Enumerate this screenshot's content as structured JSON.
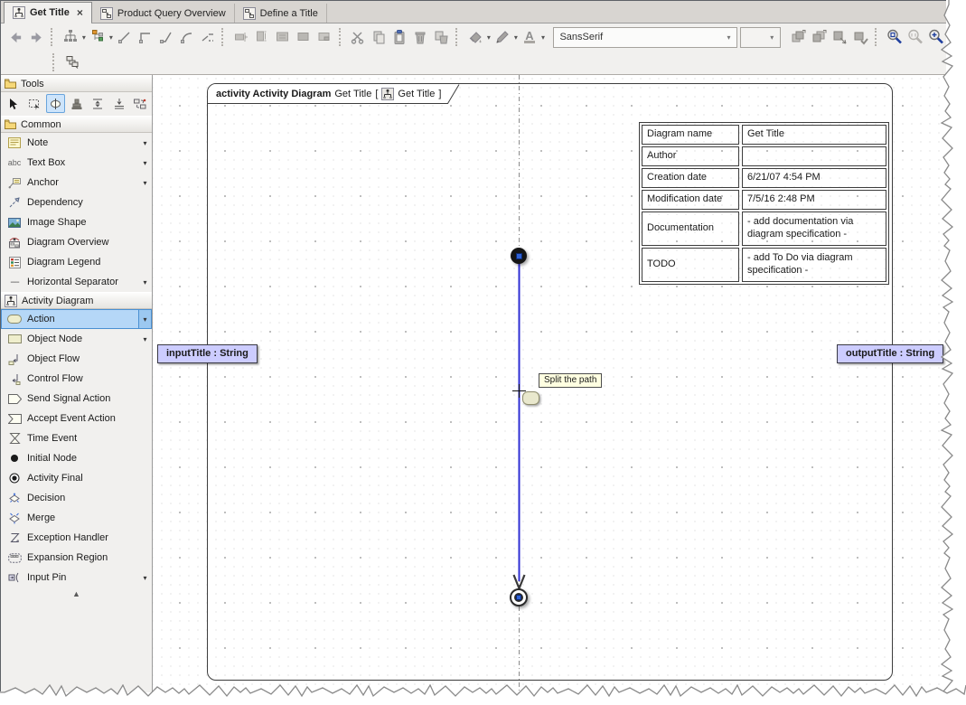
{
  "tabs": [
    {
      "label": "Get Title",
      "active": true,
      "closable": true
    },
    {
      "label": "Product Query Overview",
      "active": false
    },
    {
      "label": "Define a Title",
      "active": false
    }
  ],
  "glyphs": {
    "caret": "▾",
    "close": "×",
    "scroll_up": "▲",
    "hsep": "----",
    "abc": "abc",
    "font_a": "A"
  },
  "toolbar": {
    "font_family": "SansSerif",
    "font_size": ""
  },
  "sidebar": {
    "tools_header": "Tools",
    "common_header": "Common",
    "activity_header": "Activity Diagram",
    "common_items": [
      {
        "label": "Note",
        "icon": "note-icon",
        "dropdown": true
      },
      {
        "label": "Text Box",
        "icon": "text-box-icon",
        "dropdown": true
      },
      {
        "label": "Anchor",
        "icon": "anchor-icon",
        "dropdown": true
      },
      {
        "label": "Dependency",
        "icon": "dependency-icon",
        "dropdown": false
      },
      {
        "label": "Image Shape",
        "icon": "image-shape-icon",
        "dropdown": false
      },
      {
        "label": "Diagram Overview",
        "icon": "diagram-overview-icon",
        "dropdown": false
      },
      {
        "label": "Diagram Legend",
        "icon": "diagram-legend-icon",
        "dropdown": false
      },
      {
        "label": "Horizontal Separator",
        "icon": "horizontal-separator-icon",
        "dropdown": true
      }
    ],
    "activity_items": [
      {
        "label": "Action",
        "icon": "action-icon",
        "dropdown": true,
        "selected": true
      },
      {
        "label": "Object Node",
        "icon": "object-node-icon",
        "dropdown": true
      },
      {
        "label": "Object Flow",
        "icon": "object-flow-icon",
        "dropdown": false
      },
      {
        "label": "Control Flow",
        "icon": "control-flow-icon",
        "dropdown": false
      },
      {
        "label": "Send Signal Action",
        "icon": "send-signal-action-icon",
        "dropdown": false
      },
      {
        "label": "Accept Event Action",
        "icon": "accept-event-action-icon",
        "dropdown": false
      },
      {
        "label": "Time Event",
        "icon": "time-event-icon",
        "dropdown": false
      },
      {
        "label": "Initial Node",
        "icon": "initial-node-icon",
        "dropdown": false
      },
      {
        "label": "Activity Final",
        "icon": "activity-final-icon",
        "dropdown": false
      },
      {
        "label": "Decision",
        "icon": "decision-icon",
        "dropdown": false
      },
      {
        "label": "Merge",
        "icon": "merge-icon",
        "dropdown": false
      },
      {
        "label": "Exception Handler",
        "icon": "exception-handler-icon",
        "dropdown": false
      },
      {
        "label": "Expansion Region",
        "icon": "expansion-region-icon",
        "dropdown": false
      },
      {
        "label": "Input Pin",
        "icon": "input-pin-icon",
        "dropdown": true
      }
    ]
  },
  "canvas": {
    "frame_header": {
      "bold": "activity Activity Diagram",
      "name": "Get Title",
      "open_bracket": "[",
      "bracket_name": "Get Title",
      "close_bracket": "]"
    },
    "info_table": {
      "rows": [
        {
          "label": "Diagram name",
          "value": "Get Title"
        },
        {
          "label": "Author",
          "value": ""
        },
        {
          "label": "Creation date",
          "value": "6/21/07 4:54 PM"
        },
        {
          "label": "Modification date",
          "value": "7/5/16 2:48 PM"
        },
        {
          "label": "Documentation",
          "value": "- add documentation via diagram specification -"
        },
        {
          "label": "TODO",
          "value": "- add To Do via diagram specification -"
        }
      ]
    },
    "input_label": "inputTitle : String",
    "output_label": "outputTitle : String",
    "tooltip": "Split the path"
  },
  "colors": {
    "selection_blue": "#b5d7f7",
    "selection_border": "#4a90d2",
    "control_flow_blue": "#2f2fd3",
    "pin_label_bg": "#ccccff",
    "tooltip_bg": "#ffffe1",
    "toolbar_bg": "#f1f0ee"
  }
}
